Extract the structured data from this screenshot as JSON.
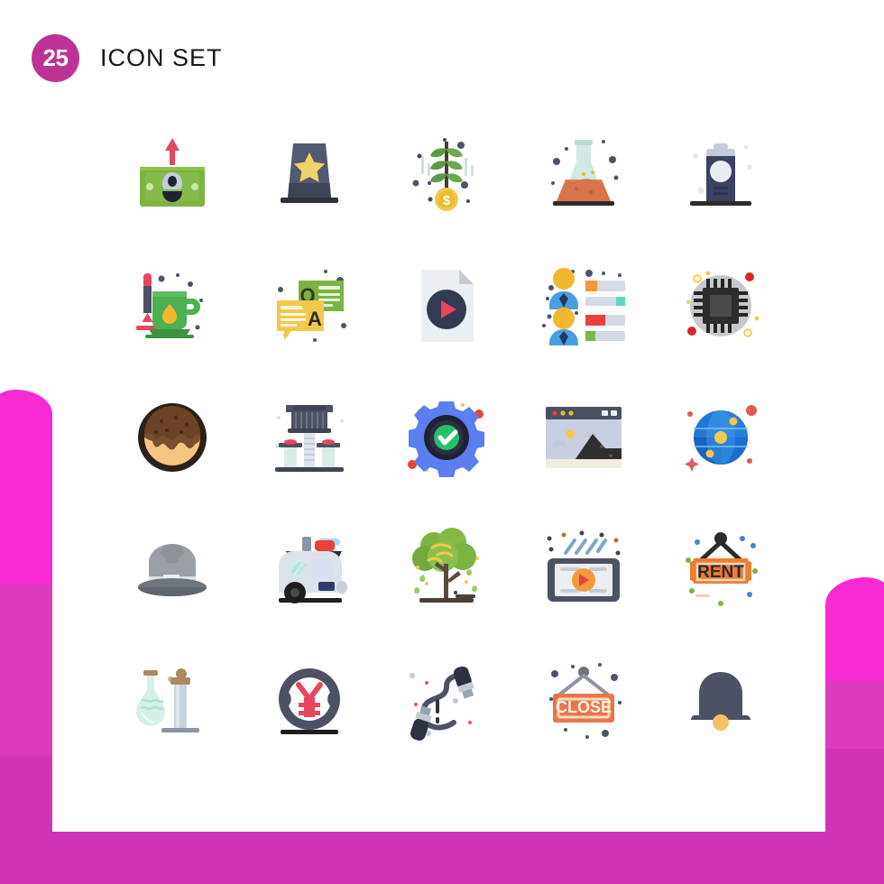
{
  "page": {
    "title": "ICON SET",
    "count": "25",
    "badge_color": "#bf3295",
    "background": "#ffffff",
    "decoration_colors": [
      "#f92ad2",
      "#dd3bbd",
      "#d035b8"
    ]
  },
  "grid": {
    "columns": 5,
    "rows": 5,
    "total": 25
  },
  "icons": [
    {
      "id": 1,
      "name": "money-up-icon",
      "label": "Money Increase",
      "row": 1,
      "col": 1,
      "colors": [
        "#7cb342",
        "#e8465f",
        "#b8b8b8"
      ]
    },
    {
      "id": 2,
      "name": "star-hat-icon",
      "label": "Star Hat",
      "row": 1,
      "col": 2,
      "colors": [
        "#515a6e",
        "#f2d06b",
        "#3d4453"
      ]
    },
    {
      "id": 3,
      "name": "money-plant-icon",
      "label": "Money Plant Growth",
      "row": 1,
      "col": 3,
      "colors": [
        "#5b9a43",
        "#f2c94c",
        "#4a5568"
      ]
    },
    {
      "id": 4,
      "name": "flask-soil-icon",
      "label": "Soil Testing Flask",
      "row": 1,
      "col": 4,
      "colors": [
        "#cfe9e5",
        "#d9734a",
        "#3d4453"
      ]
    },
    {
      "id": 5,
      "name": "coffee-cup-lid-icon",
      "label": "Coffee Cup",
      "row": 1,
      "col": 5,
      "colors": [
        "#3a4260",
        "#c5cbd9",
        "#e9edf2"
      ]
    },
    {
      "id": 6,
      "name": "tea-mug-icon",
      "label": "Hot Tea Mug",
      "row": 2,
      "col": 1,
      "colors": [
        "#4caf50",
        "#f2b830",
        "#e8465f"
      ]
    },
    {
      "id": 7,
      "name": "qa-chat-icon",
      "label": "Questions and Answers",
      "row": 2,
      "col": 2,
      "colors": [
        "#7cb342",
        "#f2c94c",
        "#3d3d3d"
      ]
    },
    {
      "id": 8,
      "name": "video-file-icon",
      "label": "Video File",
      "row": 2,
      "col": 3,
      "colors": [
        "#eceff1",
        "#343a52",
        "#e8465f"
      ]
    },
    {
      "id": 9,
      "name": "user-ranking-icon",
      "label": "User Ranking List",
      "row": 2,
      "col": 4,
      "colors": [
        "#4a9ee0",
        "#f2b830",
        "#e8465f"
      ]
    },
    {
      "id": 10,
      "name": "cpu-chip-icon",
      "label": "Processor Chip",
      "row": 2,
      "col": 5,
      "colors": [
        "#c6c9cc",
        "#2c2c2c",
        "#d32f2f"
      ]
    },
    {
      "id": 11,
      "name": "donut-icon",
      "label": "Chocolate Donut",
      "row": 3,
      "col": 1,
      "colors": [
        "#2b2118",
        "#7a4f2d",
        "#f7c583"
      ]
    },
    {
      "id": 12,
      "name": "lab-apparatus-icon",
      "label": "Lab Distillation",
      "row": 3,
      "col": 2,
      "colors": [
        "#4c5263",
        "#d8e8e5",
        "#e8465f"
      ]
    },
    {
      "id": 13,
      "name": "gear-check-icon",
      "label": "Settings Verified",
      "row": 3,
      "col": 3,
      "colors": [
        "#5b7ef0",
        "#1f2233",
        "#27c06a"
      ]
    },
    {
      "id": 14,
      "name": "browser-image-icon",
      "label": "Browser Landscape",
      "row": 3,
      "col": 4,
      "colors": [
        "#4a5160",
        "#c7cfe0",
        "#2f2f2f"
      ]
    },
    {
      "id": 15,
      "name": "globe-network-icon",
      "label": "Global Network",
      "row": 3,
      "col": 5,
      "colors": [
        "#1565c0",
        "#42a5f5",
        "#f2c94c"
      ]
    },
    {
      "id": 16,
      "name": "fedora-hat-icon",
      "label": "Fedora Hat",
      "row": 4,
      "col": 1,
      "colors": [
        "#9aa0a6",
        "#6e757c",
        "#c9ced3"
      ]
    },
    {
      "id": 17,
      "name": "caravan-trailer-icon",
      "label": "Camper Trailer",
      "row": 4,
      "col": 2,
      "colors": [
        "#dde2ea",
        "#e8465f",
        "#2f2f2f"
      ]
    },
    {
      "id": 18,
      "name": "tree-icon",
      "label": "Tree",
      "row": 4,
      "col": 3,
      "colors": [
        "#7cb342",
        "#5b4a3a",
        "#f2c94c"
      ]
    },
    {
      "id": 19,
      "name": "tablet-video-icon",
      "label": "Tablet Video Player",
      "row": 4,
      "col": 4,
      "colors": [
        "#4c5263",
        "#f2993f",
        "#e8e8e8"
      ]
    },
    {
      "id": 20,
      "name": "rent-sign-icon",
      "label": "Rent Sign",
      "row": 4,
      "col": 5,
      "colors": [
        "#ed7d31",
        "#3d3d3d",
        "#f7d9c0"
      ]
    },
    {
      "id": 21,
      "name": "chemistry-set-icon",
      "label": "Chemistry Glassware",
      "row": 5,
      "col": 1,
      "colors": [
        "#d6efe9",
        "#a98b63",
        "#c8d2dd"
      ]
    },
    {
      "id": 22,
      "name": "yen-coin-icon",
      "label": "Yen Currency",
      "row": 5,
      "col": 2,
      "colors": [
        "#4c5263",
        "#e8465f",
        "#1f1f1f"
      ]
    },
    {
      "id": 23,
      "name": "cable-connector-icon",
      "label": "Cable Connector",
      "row": 5,
      "col": 3,
      "colors": [
        "#4c5263",
        "#2c3242",
        "#e8465f"
      ]
    },
    {
      "id": 24,
      "name": "close-sign-icon",
      "label": "Close Sign",
      "row": 5,
      "col": 4,
      "colors": [
        "#e8764a",
        "#f7d9c0",
        "#6e757c"
      ]
    },
    {
      "id": 25,
      "name": "bell-icon",
      "label": "Notification Bell",
      "row": 5,
      "col": 5,
      "colors": [
        "#4c5263",
        "#f2c16b"
      ]
    }
  ],
  "sign_texts": {
    "rent": "RENT",
    "close": "CLOSE",
    "question_letter": "Q",
    "answer_letter": "A",
    "dollar_symbol": "$"
  }
}
